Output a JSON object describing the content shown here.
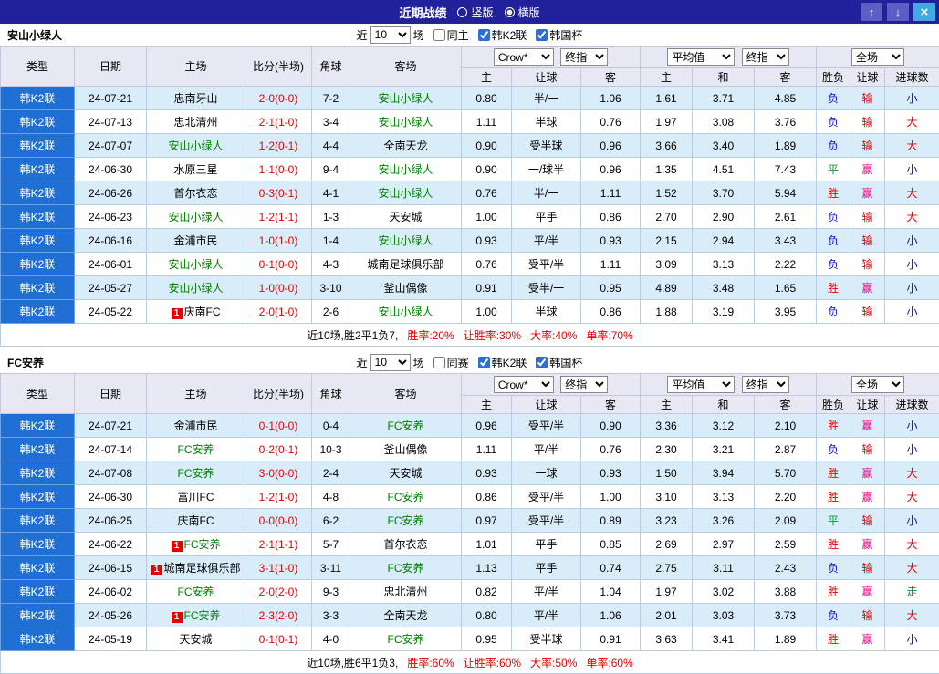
{
  "titlebar": {
    "title": "近期战绩",
    "radio_vertical": "竖版",
    "radio_horizontal": "横版",
    "selected": "横版",
    "up_icon": "↑",
    "down_icon": "↓",
    "close_icon": "×"
  },
  "filters": {
    "near": "近",
    "matches": "场",
    "k2": "韩K2联",
    "cup": "韩国杯"
  },
  "dropdowns": {
    "bookmaker": "Crow*",
    "odds_final": "终指",
    "average": "平均值",
    "avg_final": "终指",
    "scope": "全场"
  },
  "table_header": {
    "type": "类型",
    "date": "日期",
    "home": "主场",
    "score": "比分(半场)",
    "corner": "角球",
    "away": "客场",
    "odds_home": "主",
    "odds_hcap": "让球",
    "odds_away": "客",
    "avg_home": "主",
    "avg_draw": "和",
    "avg_away": "客",
    "result": "胜负",
    "hcap": "让球",
    "goals": "进球数"
  },
  "colors": {
    "titlebar_bg": "#21219b",
    "type_col_bg": "#1f6fd4",
    "header_bg": "#e8e8f4",
    "alt_row_bg": "#d9ecfa",
    "score_red": "#e60000",
    "focus_green": "#008000",
    "win_red": "#e60000",
    "draw_green": "#009933",
    "lose_blue": "#1111cc",
    "hcap_win_magenta": "#e6007f",
    "rate_red": "#e60000"
  },
  "sections": [
    {
      "team": "安山小绿人",
      "controls": {
        "count": "10",
        "same": "同主",
        "same_checked": false,
        "k2_checked": true,
        "cup_checked": true
      },
      "summary": {
        "record": "近10场,胜2平1负7,",
        "rates": [
          "胜率:20%",
          "让胜率:30%",
          "大率:40%",
          "单率:70%"
        ]
      },
      "rows": [
        {
          "league": "韩K2联",
          "date": "24-07-21",
          "home": "忠南牙山",
          "home_focus": false,
          "score": "2-0(0-0)",
          "corner": "7-2",
          "away": "安山小绿人",
          "away_focus": true,
          "odds": [
            "0.80",
            "半/一",
            "1.06"
          ],
          "avg": [
            "1.61",
            "3.71",
            "4.85"
          ],
          "result": "负",
          "hcap": "输",
          "goals": "小"
        },
        {
          "league": "韩K2联",
          "date": "24-07-13",
          "home": "忠北清州",
          "home_focus": false,
          "score": "2-1(1-0)",
          "corner": "3-4",
          "away": "安山小绿人",
          "away_focus": true,
          "odds": [
            "1.11",
            "半球",
            "0.76"
          ],
          "avg": [
            "1.97",
            "3.08",
            "3.76"
          ],
          "result": "负",
          "hcap": "输",
          "goals": "大"
        },
        {
          "league": "韩K2联",
          "date": "24-07-07",
          "home": "安山小绿人",
          "home_focus": true,
          "score": "1-2(0-1)",
          "corner": "4-4",
          "away": "全南天龙",
          "away_focus": false,
          "odds": [
            "0.90",
            "受半球",
            "0.96"
          ],
          "avg": [
            "3.66",
            "3.40",
            "1.89"
          ],
          "result": "负",
          "hcap": "输",
          "goals": "大"
        },
        {
          "league": "韩K2联",
          "date": "24-06-30",
          "home": "水原三星",
          "home_focus": false,
          "score": "1-1(0-0)",
          "corner": "9-4",
          "away": "安山小绿人",
          "away_focus": true,
          "odds": [
            "0.90",
            "一/球半",
            "0.96"
          ],
          "avg": [
            "1.35",
            "4.51",
            "7.43"
          ],
          "result": "平",
          "hcap": "赢",
          "goals": "小"
        },
        {
          "league": "韩K2联",
          "date": "24-06-26",
          "home": "首尔衣恋",
          "home_focus": false,
          "score": "0-3(0-1)",
          "corner": "4-1",
          "away": "安山小绿人",
          "away_focus": true,
          "odds": [
            "0.76",
            "半/一",
            "1.11"
          ],
          "avg": [
            "1.52",
            "3.70",
            "5.94"
          ],
          "result": "胜",
          "hcap": "赢",
          "goals": "大"
        },
        {
          "league": "韩K2联",
          "date": "24-06-23",
          "home": "安山小绿人",
          "home_focus": true,
          "score": "1-2(1-1)",
          "corner": "1-3",
          "away": "天安城",
          "away_focus": false,
          "odds": [
            "1.00",
            "平手",
            "0.86"
          ],
          "avg": [
            "2.70",
            "2.90",
            "2.61"
          ],
          "result": "负",
          "hcap": "输",
          "goals": "大"
        },
        {
          "league": "韩K2联",
          "date": "24-06-16",
          "home": "金浦市民",
          "home_focus": false,
          "score": "1-0(1-0)",
          "corner": "1-4",
          "away": "安山小绿人",
          "away_focus": true,
          "odds": [
            "0.93",
            "平/半",
            "0.93"
          ],
          "avg": [
            "2.15",
            "2.94",
            "3.43"
          ],
          "result": "负",
          "hcap": "输",
          "goals": "小"
        },
        {
          "league": "韩K2联",
          "date": "24-06-01",
          "home": "安山小绿人",
          "home_focus": true,
          "score": "0-1(0-0)",
          "corner": "4-3",
          "away": "城南足球俱乐部",
          "away_focus": false,
          "odds": [
            "0.76",
            "受平/半",
            "1.11"
          ],
          "avg": [
            "3.09",
            "3.13",
            "2.22"
          ],
          "result": "负",
          "hcap": "输",
          "goals": "小"
        },
        {
          "league": "韩K2联",
          "date": "24-05-27",
          "home": "安山小绿人",
          "home_focus": true,
          "score": "1-0(0-0)",
          "corner": "3-10",
          "away": "釜山偶像",
          "away_focus": false,
          "odds": [
            "0.91",
            "受半/一",
            "0.95"
          ],
          "avg": [
            "4.89",
            "3.48",
            "1.65"
          ],
          "result": "胜",
          "hcap": "赢",
          "goals": "小"
        },
        {
          "league": "韩K2联",
          "date": "24-05-22",
          "home": "庆南FC",
          "home_focus": false,
          "home_card": "1",
          "score": "2-0(1-0)",
          "corner": "2-6",
          "away": "安山小绿人",
          "away_focus": true,
          "odds": [
            "1.00",
            "半球",
            "0.86"
          ],
          "avg": [
            "1.88",
            "3.19",
            "3.95"
          ],
          "result": "负",
          "hcap": "输",
          "goals": "小"
        }
      ]
    },
    {
      "team": "FC安养",
      "controls": {
        "count": "10",
        "same": "同赛",
        "same_checked": false,
        "k2_checked": true,
        "cup_checked": true
      },
      "summary": {
        "record": "近10场,胜6平1负3,",
        "rates": [
          "胜率:60%",
          "让胜率:60%",
          "大率:50%",
          "单率:60%"
        ]
      },
      "rows": [
        {
          "league": "韩K2联",
          "date": "24-07-21",
          "home": "金浦市民",
          "home_focus": false,
          "score": "0-1(0-0)",
          "corner": "0-4",
          "away": "FC安养",
          "away_focus": true,
          "odds": [
            "0.96",
            "受平/半",
            "0.90"
          ],
          "avg": [
            "3.36",
            "3.12",
            "2.10"
          ],
          "result": "胜",
          "hcap": "赢",
          "goals": "小"
        },
        {
          "league": "韩K2联",
          "date": "24-07-14",
          "home": "FC安养",
          "home_focus": true,
          "score": "0-2(0-1)",
          "corner": "10-3",
          "away": "釜山偶像",
          "away_focus": false,
          "odds": [
            "1.11",
            "平/半",
            "0.76"
          ],
          "avg": [
            "2.30",
            "3.21",
            "2.87"
          ],
          "result": "负",
          "hcap": "输",
          "goals": "小"
        },
        {
          "league": "韩K2联",
          "date": "24-07-08",
          "home": "FC安养",
          "home_focus": true,
          "score": "3-0(0-0)",
          "corner": "2-4",
          "away": "天安城",
          "away_focus": false,
          "odds": [
            "0.93",
            "一球",
            "0.93"
          ],
          "avg": [
            "1.50",
            "3.94",
            "5.70"
          ],
          "result": "胜",
          "hcap": "赢",
          "goals": "大"
        },
        {
          "league": "韩K2联",
          "date": "24-06-30",
          "home": "富川FC",
          "home_focus": false,
          "score": "1-2(1-0)",
          "corner": "4-8",
          "away": "FC安养",
          "away_focus": true,
          "odds": [
            "0.86",
            "受平/半",
            "1.00"
          ],
          "avg": [
            "3.10",
            "3.13",
            "2.20"
          ],
          "result": "胜",
          "hcap": "赢",
          "goals": "大"
        },
        {
          "league": "韩K2联",
          "date": "24-06-25",
          "home": "庆南FC",
          "home_focus": false,
          "score": "0-0(0-0)",
          "corner": "6-2",
          "away": "FC安养",
          "away_focus": true,
          "odds": [
            "0.97",
            "受平/半",
            "0.89"
          ],
          "avg": [
            "3.23",
            "3.26",
            "2.09"
          ],
          "result": "平",
          "hcap": "输",
          "goals": "小"
        },
        {
          "league": "韩K2联",
          "date": "24-06-22",
          "home": "FC安养",
          "home_focus": true,
          "home_card": "1",
          "score": "2-1(1-1)",
          "corner": "5-7",
          "away": "首尔衣恋",
          "away_focus": false,
          "odds": [
            "1.01",
            "平手",
            "0.85"
          ],
          "avg": [
            "2.69",
            "2.97",
            "2.59"
          ],
          "result": "胜",
          "hcap": "赢",
          "goals": "大"
        },
        {
          "league": "韩K2联",
          "date": "24-06-15",
          "home": "城南足球俱乐部",
          "home_focus": false,
          "home_card": "1",
          "score": "3-1(1-0)",
          "corner": "3-11",
          "away": "FC安养",
          "away_focus": true,
          "odds": [
            "1.13",
            "平手",
            "0.74"
          ],
          "avg": [
            "2.75",
            "3.11",
            "2.43"
          ],
          "result": "负",
          "hcap": "输",
          "goals": "大"
        },
        {
          "league": "韩K2联",
          "date": "24-06-02",
          "home": "FC安养",
          "home_focus": true,
          "score": "2-0(2-0)",
          "corner": "9-3",
          "away": "忠北清州",
          "away_focus": false,
          "odds": [
            "0.82",
            "平/半",
            "1.04"
          ],
          "avg": [
            "1.97",
            "3.02",
            "3.88"
          ],
          "result": "胜",
          "hcap": "赢",
          "goals": "走"
        },
        {
          "league": "韩K2联",
          "date": "24-05-26",
          "home": "FC安养",
          "home_focus": true,
          "home_card": "1",
          "score": "2-3(2-0)",
          "corner": "3-3",
          "away": "全南天龙",
          "away_focus": false,
          "odds": [
            "0.80",
            "平/半",
            "1.06"
          ],
          "avg": [
            "2.01",
            "3.03",
            "3.73"
          ],
          "result": "负",
          "hcap": "输",
          "goals": "大"
        },
        {
          "league": "韩K2联",
          "date": "24-05-19",
          "home": "天安城",
          "home_focus": false,
          "score": "0-1(0-1)",
          "corner": "4-0",
          "away": "FC安养",
          "away_focus": true,
          "odds": [
            "0.95",
            "受半球",
            "0.91"
          ],
          "avg": [
            "3.63",
            "3.41",
            "1.89"
          ],
          "result": "胜",
          "hcap": "赢",
          "goals": "小"
        }
      ]
    }
  ]
}
